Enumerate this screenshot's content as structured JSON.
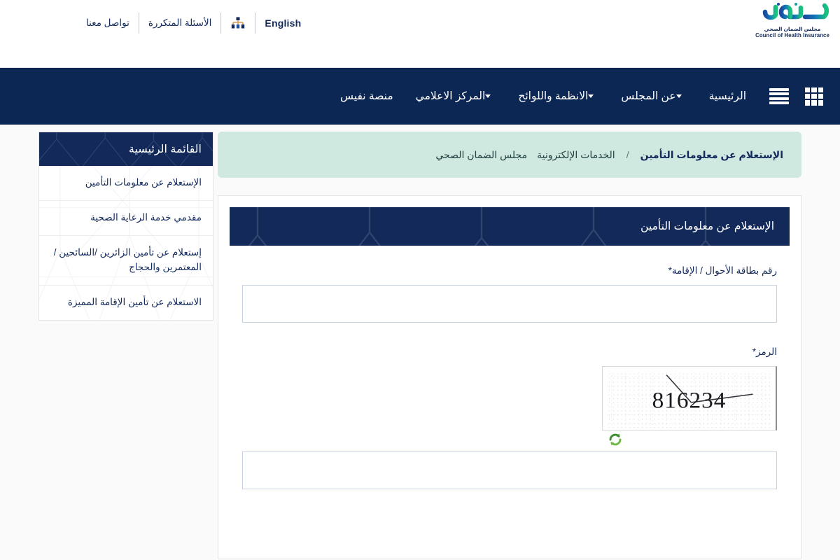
{
  "topbar": {
    "language_label": "English",
    "sitemap_icon": "sitemap-icon",
    "faq_label": "الأسئلة المتكررة",
    "contact_label": "تواصل معنا"
  },
  "logo": {
    "wordmark": "ضمان",
    "subtitle_ar": "مجلس الضمان الصحي",
    "subtitle_en": "Council of Health Insurance",
    "color_blue": "#1a4b9e",
    "color_green": "#19c37d"
  },
  "nav": {
    "grid_icon": "grid-apps-icon",
    "menu_icon": "hamburger-menu-icon",
    "items": [
      {
        "label": "الرئيسية",
        "has_dropdown": false
      },
      {
        "label": "عن المجلس",
        "has_dropdown": true
      },
      {
        "label": "الانظمة واللوائح",
        "has_dropdown": true
      },
      {
        "label": "المركز الاعلامي",
        "has_dropdown": true
      },
      {
        "label": "منصة نفيس",
        "has_dropdown": false
      }
    ],
    "background_color": "#0d2755"
  },
  "breadcrumb": {
    "background_color": "#cfe8e0",
    "items": [
      {
        "label": "مجلس الضمان الصحي",
        "current": false
      },
      {
        "label": "الخدمات الإلكترونية",
        "current": false
      },
      {
        "label": "الإستعلام عن معلومات التأمين",
        "current": true
      }
    ],
    "separator": "/"
  },
  "sidebar": {
    "title": "القائمة الرئيسية",
    "items": [
      {
        "label": "الإستعلام عن معلومات التأمين"
      },
      {
        "label": "مقدمي خدمة الرعاية الصحية"
      },
      {
        "label": "إستعلام عن تأمين الزائرين /السائحين / المعتمرين والحجاج"
      },
      {
        "label": "الاستعلام عن تأمين الإقامة المميزة"
      }
    ]
  },
  "form": {
    "panel_title": "الإستعلام عن معلومات التأمين",
    "id_field": {
      "label": "رقم بطاقة الأحوال / الإقامة*",
      "value": "",
      "placeholder": ""
    },
    "captcha_field": {
      "label": "الرمز*",
      "code": "816234",
      "value": "",
      "placeholder": "",
      "refresh_icon": "refresh-icon"
    }
  },
  "theme": {
    "navy": "#0d2755",
    "navy_dark": "#12295a",
    "mint": "#cfe8e0",
    "page_bg": "#fafafa",
    "input_border": "#c9d2e0"
  }
}
